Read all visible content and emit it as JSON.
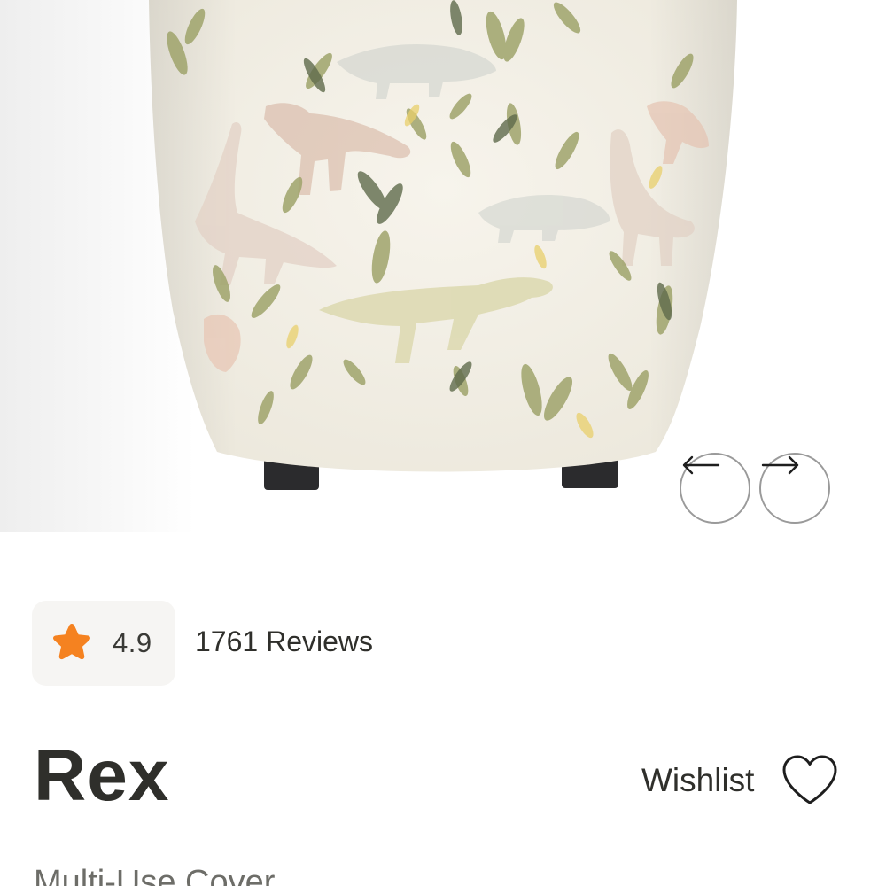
{
  "product": {
    "title": "Rex",
    "subtitle": "Multi-Use Cover",
    "image_alt": "Dinosaur print multi-use cover on a chair"
  },
  "carousel": {
    "prev_icon": "arrow-left-icon",
    "next_icon": "arrow-right-icon"
  },
  "rating": {
    "score": "4.9",
    "reviews_label": "1761 Reviews",
    "star_color": "#f58220",
    "icon": "star-icon"
  },
  "wishlist": {
    "label": "Wishlist",
    "icon": "heart-outline-icon"
  }
}
